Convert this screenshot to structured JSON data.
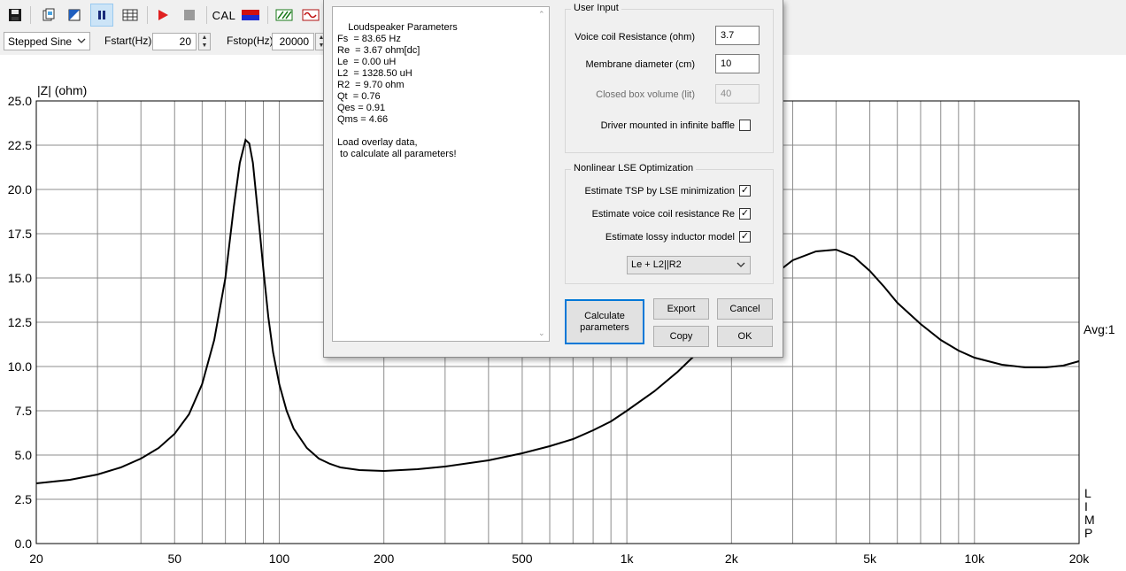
{
  "toolbar": {
    "cal_label": "CAL",
    "icons": [
      "save-icon",
      "copy-icon",
      "mode-icon",
      "pause-icon",
      "table-icon",
      "play-icon",
      "stop-icon",
      "cal-icon",
      "impedance-icon",
      "bandpass-icon",
      "sine-icon"
    ],
    "signal_type": "Stepped Sine",
    "fstart_label": "Fstart(Hz)",
    "fstart_value": "20",
    "fstop_label": "Fstop(Hz)",
    "fstop_value": "20000"
  },
  "dialog": {
    "results_text": "Loudspeaker Parameters\nFs  = 83.65 Hz\nRe  = 3.67 ohm[dc]\nLe  = 0.00 uH\nL2  = 1328.50 uH\nR2  = 9.70 ohm\nQt  = 0.76\nQes = 0.91\nQms = 4.66\n\nLoad overlay data,\n to calculate all parameters!",
    "user_input": {
      "title": "User Input",
      "voice_coil_label": "Voice coil Resistance (ohm)",
      "voice_coil_value": "3.7",
      "membrane_label": "Membrane diameter (cm)",
      "membrane_value": "10",
      "box_volume_label": "Closed box volume (lit)",
      "box_volume_value": "40",
      "infinite_baffle_label": "Driver mounted in infinite baffle",
      "infinite_baffle_checked": false
    },
    "nonlinear": {
      "title": "Nonlinear LSE Optimization",
      "estimate_tsp_label": "Estimate TSP by LSE minimization",
      "estimate_re_label": "Estimate voice coil resistance Re",
      "estimate_lossy_label": "Estimate lossy inductor model",
      "check_mark": "✓",
      "model_select": "Le + L2||R2"
    },
    "buttons": {
      "calculate": "Calculate parameters",
      "export": "Export",
      "cancel": "Cancel",
      "copy": "Copy",
      "ok": "OK"
    }
  },
  "chart_data": {
    "type": "line",
    "ylabel": "|Z| (ohm)",
    "xscale": "log",
    "xlim": [
      20,
      20000
    ],
    "ylim": [
      0,
      25
    ],
    "grid": true,
    "y_ticks": [
      "25.0",
      "22.5",
      "20.0",
      "17.5",
      "15.0",
      "12.5",
      "10.0",
      "7.5",
      "5.0",
      "2.5",
      "0.0"
    ],
    "x_tick_labels": [
      {
        "x": 20,
        "label": "20"
      },
      {
        "x": 50,
        "label": "50"
      },
      {
        "x": 100,
        "label": "100"
      },
      {
        "x": 200,
        "label": "200"
      },
      {
        "x": 500,
        "label": "500"
      },
      {
        "x": 1000,
        "label": "1k"
      },
      {
        "x": 2000,
        "label": "2k"
      },
      {
        "x": 5000,
        "label": "5k"
      },
      {
        "x": 10000,
        "label": "10k"
      },
      {
        "x": 20000,
        "label": "20k"
      }
    ],
    "avg_label": "Avg:1",
    "side_label": "LIMP",
    "series": [
      {
        "x": [
          20,
          25,
          30,
          35,
          40,
          45,
          50,
          55,
          60,
          65,
          70,
          74,
          77,
          80,
          82,
          84,
          86,
          88,
          90,
          93,
          96,
          100,
          105,
          110,
          120,
          130,
          140,
          150,
          170,
          200,
          250,
          300,
          400,
          500,
          600,
          700,
          800,
          900,
          1000,
          1200,
          1400,
          1600,
          1800,
          2000,
          2200,
          2500,
          3000,
          3500,
          4000,
          4500,
          5000,
          5500,
          6000,
          7000,
          8000,
          9000,
          10000,
          12000,
          14000,
          16000,
          18000,
          20000
        ],
        "y": [
          3.4,
          3.6,
          3.9,
          4.3,
          4.8,
          5.4,
          6.2,
          7.3,
          9.0,
          11.5,
          15.0,
          19.0,
          21.5,
          22.8,
          22.6,
          21.5,
          19.5,
          17.5,
          15.5,
          12.8,
          10.8,
          9.0,
          7.5,
          6.5,
          5.4,
          4.8,
          4.5,
          4.3,
          4.15,
          4.1,
          4.2,
          4.35,
          4.7,
          5.1,
          5.5,
          5.9,
          6.4,
          6.9,
          7.5,
          8.6,
          9.7,
          10.8,
          11.9,
          12.8,
          13.7,
          14.8,
          16.0,
          16.5,
          16.6,
          16.2,
          15.4,
          14.5,
          13.6,
          12.4,
          11.5,
          10.9,
          10.5,
          10.1,
          9.95,
          9.95,
          10.05,
          10.3
        ]
      }
    ]
  }
}
